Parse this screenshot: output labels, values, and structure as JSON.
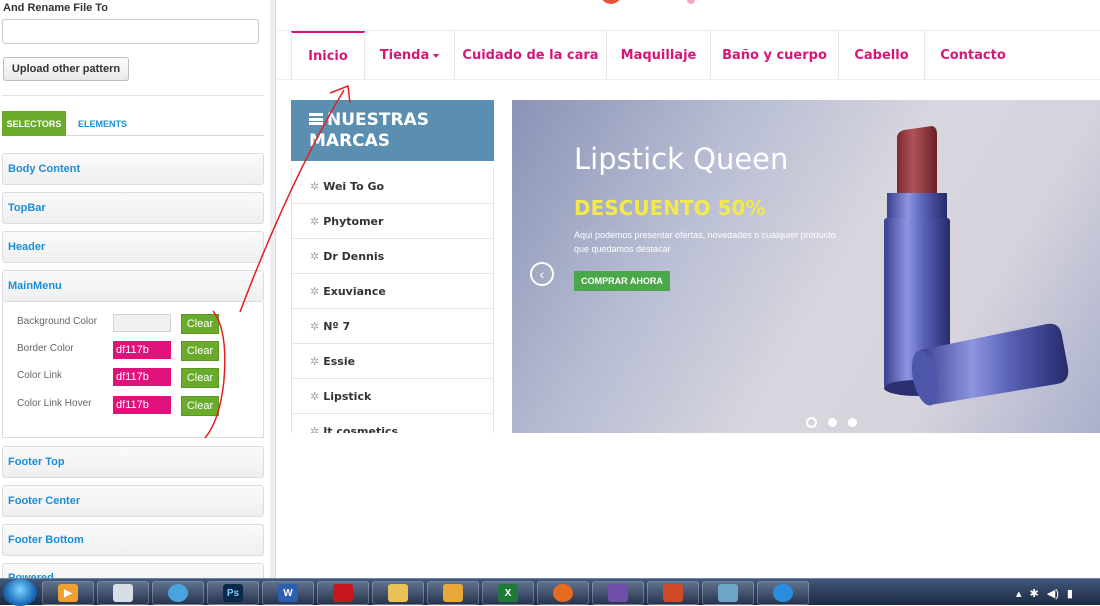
{
  "editor": {
    "rename_label": "And Rename File To",
    "rename_value": "",
    "upload_button": "Upload other pattern",
    "tabs": {
      "selectors": "SELECTORS",
      "elements": "ELEMENTS"
    },
    "sections": {
      "body_content": "Body Content",
      "topbar": "TopBar",
      "header": "Header",
      "mainmenu": "MainMenu",
      "footer_top": "Footer Top",
      "footer_center": "Footer Center",
      "footer_bottom": "Footer Bottom",
      "powered": "Powered"
    },
    "mainmenu_props": [
      {
        "label": "Background Color",
        "value": ""
      },
      {
        "label": "Border Color",
        "value": "df117b"
      },
      {
        "label": "Color Link",
        "value": "df117b"
      },
      {
        "label": "Color Link Hover",
        "value": "df117b"
      }
    ],
    "clear_label": "Clear"
  },
  "site": {
    "nav": [
      "Inicio",
      "Tienda",
      "Cuidado de la cara",
      "Maquillaje",
      "Baño y cuerpo",
      "Cabello",
      "Contacto"
    ],
    "brands": {
      "title_line1": "NUESTRAS",
      "title_line2": "MARCAS",
      "items": [
        "Wei To Go",
        "Phytomer",
        "Dr Dennis",
        "Exuviance",
        "Nº 7",
        "Essie",
        "Lipstick",
        "It cosmetics"
      ]
    },
    "slider": {
      "title": "Lipstick Queen",
      "subtitle": "DESCUENTO 50%",
      "description": "Aquí podemos presentar ofertas, novedades o cualquier producto que quedamos destacar",
      "button": "COMPRAR AHORA"
    }
  },
  "colors": {
    "brand_pink": "#df117b",
    "green": "#6aab2c",
    "brands_blue": "#5b8fb2",
    "link_blue": "#1a8fd8"
  },
  "taskbar": {
    "apps": [
      "media-player-icon",
      "notepad-icon",
      "safari-icon",
      "photoshop-icon",
      "word-icon",
      "acrobat-icon",
      "folder-icon",
      "outlook-icon",
      "excel-icon",
      "firefox-icon",
      "audio-icon",
      "app-icon",
      "network-icon",
      "ie-icon"
    ],
    "photoshop_label": "Ps",
    "word_label": "W",
    "excel_label": "X"
  }
}
